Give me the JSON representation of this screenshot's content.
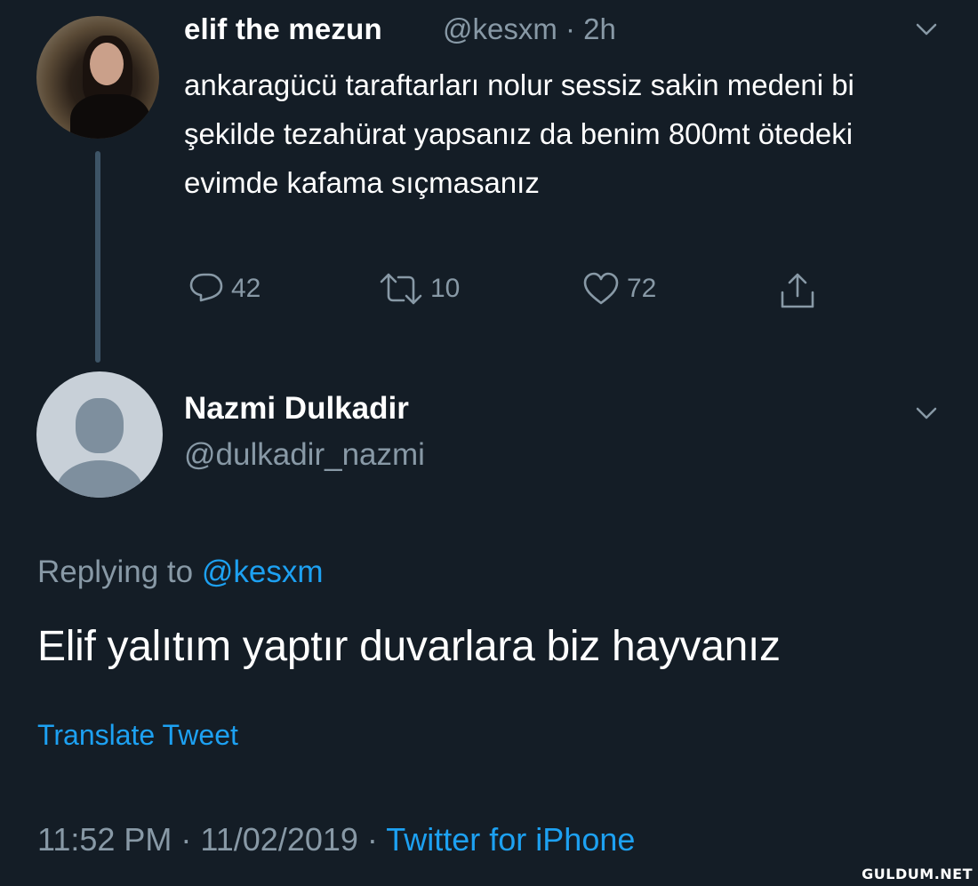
{
  "tweet1": {
    "name": "elif the mezun",
    "handle_time": "@kesxm · 2h",
    "text": "ankaragücü taraftarları nolur sessiz sakin medeni bi şekilde tezahürat yapsanız da benim 800mt ötedeki evimde kafama sıçmasanız",
    "reply_count": "42",
    "retweet_count": "10",
    "like_count": "72"
  },
  "tweet2": {
    "name": "Nazmi Dulkadir",
    "handle": "@dulkadir_nazmi",
    "replying_prefix": "Replying to",
    "replying_handle": "@kesxm",
    "text": "Elif yalıtım yaptır duvarlara biz hayvanız",
    "translate_label": "Translate Tweet",
    "timestamp": "11:52 PM · 11/02/2019 · ",
    "source": "Twitter for iPhone"
  },
  "watermark": "GULDUM.NET",
  "colors": {
    "background": "#141d26",
    "secondary_text": "#8899a6",
    "accent": "#1da1f2",
    "thread_line": "#3d5466"
  },
  "icons": [
    "chevron-down-icon",
    "reply-icon",
    "retweet-icon",
    "like-icon",
    "share-icon"
  ]
}
